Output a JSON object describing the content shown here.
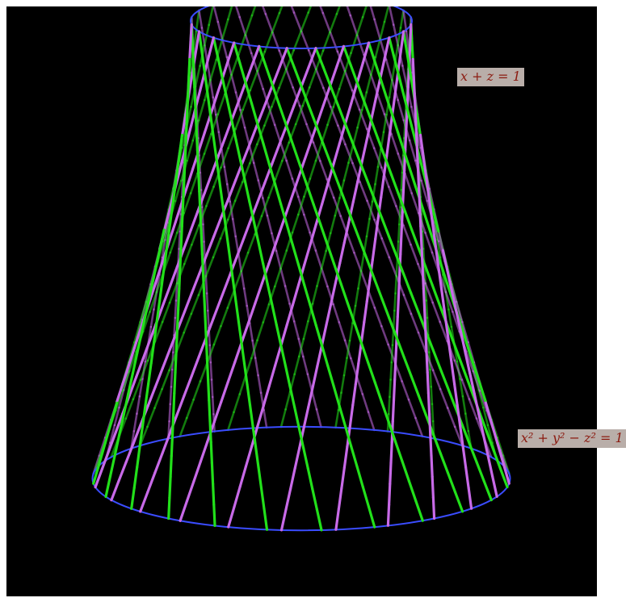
{
  "labels": {
    "plane": "x + z = 1",
    "hyperboloid": "x² + y² − z² = 1"
  },
  "colors": {
    "background": "#000000",
    "green_rulings": "#22e01a",
    "purple_rulings": "#c86ae8",
    "rim_circles": "#3a4cff",
    "label_background": "#b9aea9",
    "label_text": "#8b1a10"
  },
  "surface": {
    "equation": "x² + y² − z² = 1",
    "ruling_families": 2,
    "rulings_per_family": 24,
    "z_range": [
      -1.6,
      0.0
    ]
  },
  "plane": {
    "equation": "x + z = 1"
  }
}
